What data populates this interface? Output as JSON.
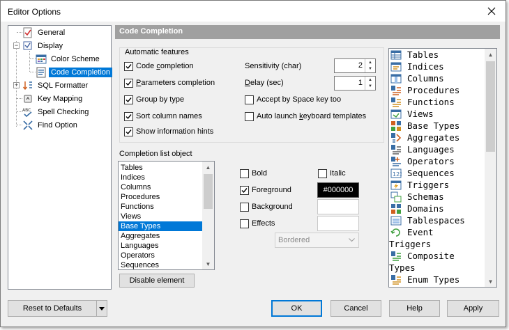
{
  "window": {
    "title": "Editor Options"
  },
  "tree": {
    "items": [
      {
        "label": "General",
        "icon": "checkmark-document-icon"
      },
      {
        "label": "Display",
        "icon": "checkbox-icon"
      },
      {
        "label": "Color Scheme",
        "icon": "grid-palette-icon"
      },
      {
        "label": "Code Completion",
        "icon": "completion-list-icon"
      },
      {
        "label": "SQL Formatter",
        "icon": "sort-arrows-icon"
      },
      {
        "label": "Key Mapping",
        "icon": "keyboard-icon"
      },
      {
        "label": "Spell Checking",
        "icon": "abc-spellcheck-icon"
      },
      {
        "label": "Find Option",
        "icon": "find-arrows-icon"
      }
    ]
  },
  "panel": {
    "title": "Code Completion"
  },
  "automatic": {
    "title": "Automatic features",
    "options": [
      {
        "pre": "Code ",
        "u": "c",
        "post": "ompletion",
        "checked": true
      },
      {
        "pre": "",
        "u": "P",
        "post": "arameters completion",
        "checked": true
      },
      {
        "pre": "Group by type",
        "u": "",
        "post": "",
        "checked": true
      },
      {
        "pre": "Sort column names",
        "u": "",
        "post": "",
        "checked": true
      },
      {
        "pre": "Show information hints",
        "u": "",
        "post": "",
        "checked": true
      }
    ],
    "sensitivity": {
      "label": "Sensitivity (char)",
      "value": "2"
    },
    "delay": {
      "pre": "",
      "u": "D",
      "post": "elay (sec)",
      "value": "1"
    },
    "accept_space": {
      "label": "Accept by Space key too",
      "checked": false
    },
    "auto_launch": {
      "pre": "Auto launch ",
      "u": "k",
      "post": "eyboard templates",
      "checked": false
    }
  },
  "completion_list": {
    "title": "Completion list object",
    "items": [
      "Tables",
      "Indices",
      "Columns",
      "Procedures",
      "Functions",
      "Views",
      "Base Types",
      "Aggregates",
      "Languages",
      "Operators",
      "Sequences"
    ],
    "selected": "Base Types",
    "disable_button": "Disable element"
  },
  "style": {
    "bold": {
      "label": "Bold",
      "checked": false
    },
    "italic": {
      "label": "Italic",
      "checked": false
    },
    "foreground": {
      "label": "Foreground",
      "checked": true,
      "color": "#000000"
    },
    "background": {
      "label": "Background",
      "checked": false
    },
    "effects": {
      "label": "Effects",
      "checked": false
    },
    "effect_select": "Bordered"
  },
  "object_list": {
    "rows": [
      {
        "text": "Tables",
        "icon": "table-icon"
      },
      {
        "text": "Indices",
        "icon": "index-icon"
      },
      {
        "text": "Columns",
        "icon": "column-icon"
      },
      {
        "text": "Procedures",
        "icon": "procedure-icon"
      },
      {
        "text": "Functions",
        "icon": "function-icon"
      },
      {
        "text": "Views",
        "icon": "view-icon"
      },
      {
        "text": "Base Types",
        "icon": "type-icon"
      },
      {
        "text": "Aggregates",
        "icon": "aggregate-icon"
      },
      {
        "text": "Languages",
        "icon": "language-icon"
      },
      {
        "text": "Operators",
        "icon": "operator-icon"
      },
      {
        "text": "Sequences",
        "icon": "sequence-icon"
      },
      {
        "text": "Triggers",
        "icon": "trigger-icon"
      },
      {
        "text": "Schemas",
        "icon": "schema-icon"
      },
      {
        "text": "Domains",
        "icon": "domain-icon"
      },
      {
        "text": "Tablespaces",
        "icon": "tablespace-icon"
      },
      {
        "text": "Event",
        "icon": "event-trigger-icon"
      },
      {
        "text": "Triggers",
        "icon": ""
      },
      {
        "text": "Composite",
        "icon": "composite-type-icon"
      },
      {
        "text": "Types",
        "icon": ""
      },
      {
        "text": "Enum Types",
        "icon": "enum-type-icon"
      }
    ]
  },
  "footer": {
    "reset": "Reset to Defaults",
    "ok": "OK",
    "cancel": "Cancel",
    "help": "Help",
    "apply": "Apply"
  }
}
